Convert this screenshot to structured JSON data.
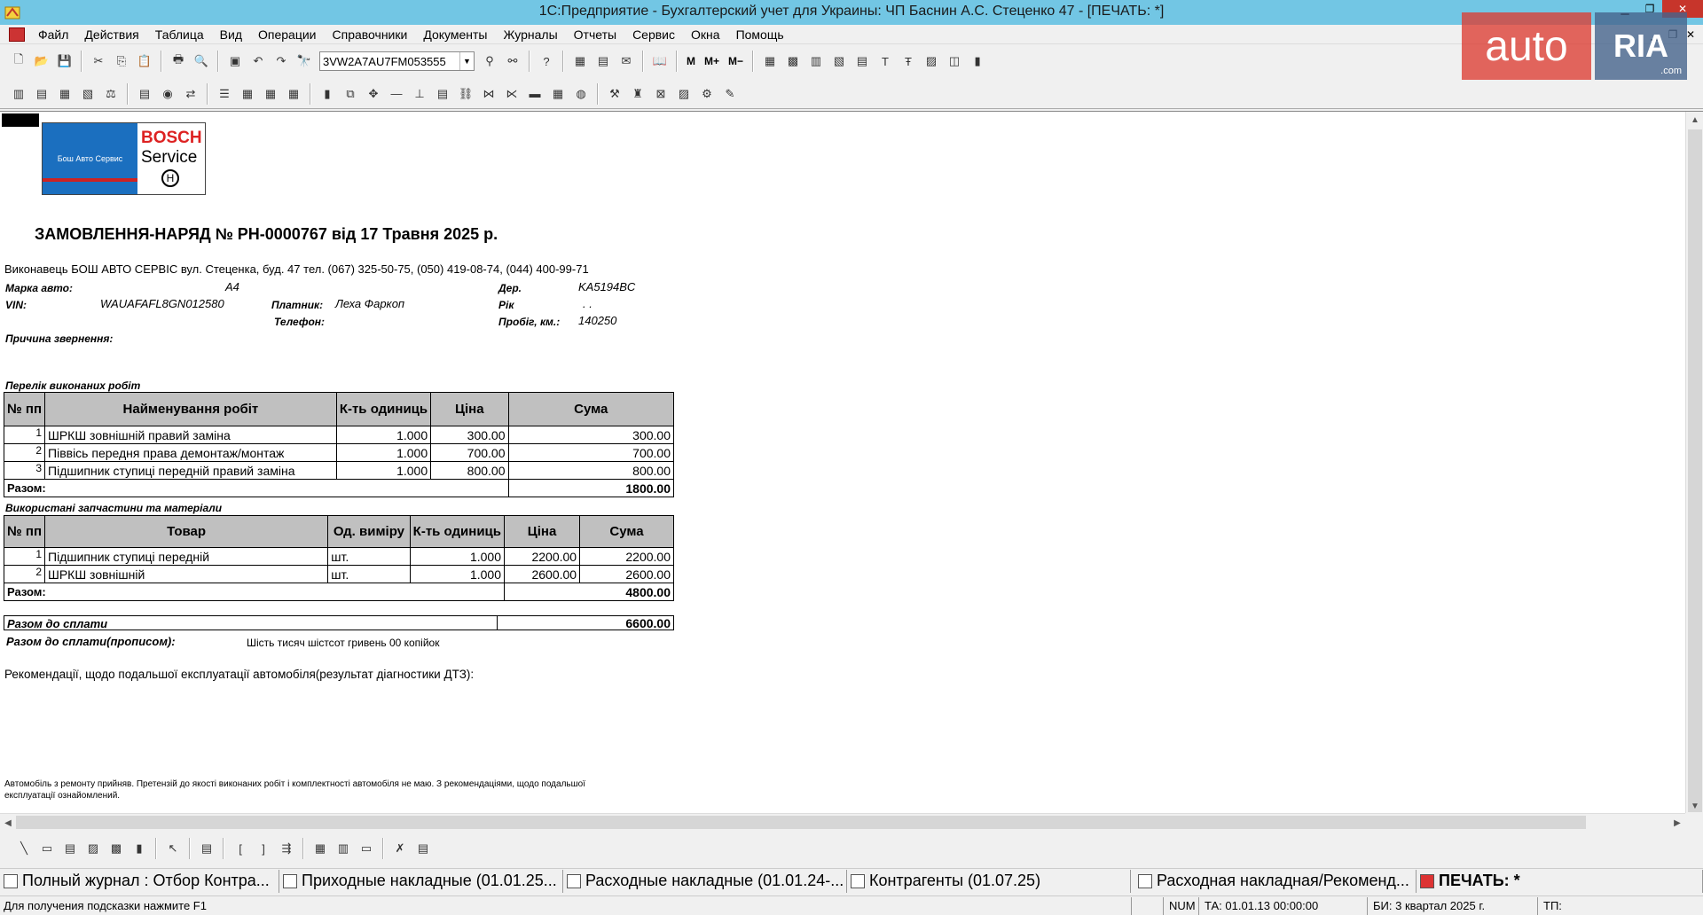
{
  "window": {
    "title": "1С:Предприятие - Бухгалтерский учет для Украины: ЧП Баснин А.С.  Стеценко 47 - [ПЕЧАТЬ:  *]"
  },
  "menu": [
    "Файл",
    "Действия",
    "Таблица",
    "Вид",
    "Операции",
    "Справочники",
    "Документы",
    "Журналы",
    "Отчеты",
    "Сервис",
    "Окна",
    "Помощь"
  ],
  "toolbar": {
    "search_value": "3VW2A7AU7FM053555",
    "m_label": "M",
    "m_plus_label": "M+",
    "m_minus_label": "M−"
  },
  "watermark": {
    "auto": "auto",
    "ria": "RIA",
    "com": ".com"
  },
  "document": {
    "logo_left_text": "Бош Авто Сервис",
    "logo_brand": "BOSCH",
    "logo_service": "Service",
    "title": "ЗАМОВЛЕННЯ-НАРЯД   № РН-0000767  від 17 Травня 2025 р.",
    "executor": "Виконавець БОШ АВТО СЕРВІС  вул. Стеценка, буд. 47 тел. (067) 325-50-75, (050) 419-08-74, (044) 400-99-71",
    "car_make_label": "Марка авто:",
    "car_make_value": "A4",
    "vin_label": "VIN:",
    "vin_value": "WAUAFAFL8GN012580",
    "payer_label": "Платник:",
    "payer_value": "Леха Фаркоп",
    "phone_label": "Телефон:",
    "reg_label": "Дер.",
    "reg_value": "KA5194BC",
    "year_label": "Рік",
    "year_value": ". .",
    "mileage_label": "Пробіг, км.:",
    "mileage_value": "140250",
    "reason_label": "Причина звернення:",
    "works_caption": "Перелік виконаних робіт",
    "works_headers": {
      "no": "№ пп",
      "name": "Найменування робіт",
      "qty": "К-ть одиниць",
      "price": "Ціна",
      "sum": "Сума"
    },
    "works": [
      {
        "no": "1",
        "name": "ШРКШ зовнішній правий заміна",
        "qty": "1.000",
        "price": "300.00",
        "sum": "300.00"
      },
      {
        "no": "2",
        "name": "Піввісь передня права демонтаж/монтаж",
        "qty": "1.000",
        "price": "700.00",
        "sum": "700.00"
      },
      {
        "no": "3",
        "name": "Підшипник ступиці передній правий заміна",
        "qty": "1.000",
        "price": "800.00",
        "sum": "800.00"
      }
    ],
    "works_total_label": "Разом:",
    "works_total": "1800.00",
    "parts_caption": "Використані запчастини та матеріали",
    "parts_headers": {
      "no": "№ пп",
      "name": "Товар",
      "unit": "Од. виміру",
      "qty": "К-ть одиниць",
      "price": "Ціна",
      "sum": "Сума"
    },
    "parts": [
      {
        "no": "1",
        "name": "Підшипник ступиці передній",
        "unit": "шт.",
        "qty": "1.000",
        "price": "2200.00",
        "sum": "2200.00"
      },
      {
        "no": "2",
        "name": "ШРКШ зовнішній",
        "unit": "шт.",
        "qty": "1.000",
        "price": "2600.00",
        "sum": "2600.00"
      }
    ],
    "parts_total_label": "Разом:",
    "parts_total": "4800.00",
    "grand_total_label": "Разом до сплати",
    "grand_total": "6600.00",
    "words_label": "Разом до сплати(прописом):",
    "words_value": "Шість тисяч шістсот гривень 00 копійок",
    "recommendations": "Рекомендації, щодо подальшої експлуатації автомобіля(результат діагностики ДТЗ):",
    "footer_line1": "Автомобіль з ремонту прийняв. Претензій до якості виконаних робіт і комплектності автомобіля не маю. З рекомендаціями, щодо подальшої",
    "footer_line2": "експлуатації ознайомлений."
  },
  "tasks": [
    "Полный журнал : Отбор Контра...",
    "Приходные накладные (01.01.25...",
    "Расходные накладные (01.01.24-...",
    "Контрагенты (01.07.25)",
    "Расходная накладная/Рекоменд...",
    "ПЕЧАТЬ:  *"
  ],
  "status": {
    "hint": "Для получения подсказки нажмите F1",
    "num": "NUM",
    "ta": "ТА: 01.01.13  00:00:00",
    "bi": "БИ: 3 квартал 2025 г.",
    "tp": "ТП:"
  }
}
